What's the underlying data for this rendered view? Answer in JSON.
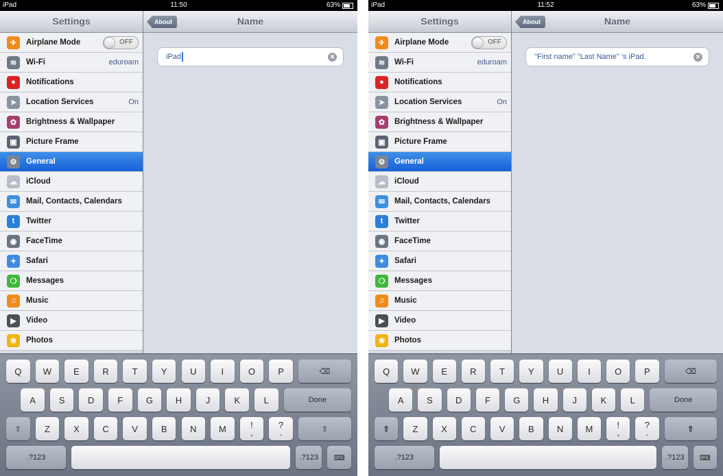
{
  "screens": [
    {
      "status": {
        "carrier": "iPad",
        "time": "11:50",
        "battery": "63%"
      },
      "sidebar_title": "Settings",
      "items": [
        {
          "label": "Airplane Mode",
          "toggle": "OFF",
          "icon": "airplane-icon",
          "color": "#f08a1a",
          "glyph": "✈"
        },
        {
          "label": "Wi-Fi",
          "value": "eduroam",
          "icon": "wifi-icon",
          "color": "#6f7a88",
          "glyph": "≋"
        },
        {
          "label": "Notifications",
          "icon": "notifications-icon",
          "color": "#d92424",
          "glyph": "●"
        },
        {
          "label": "Location Services",
          "value": "On",
          "icon": "location-icon",
          "color": "#8892a0",
          "glyph": "➤"
        },
        {
          "label": "Brightness & Wallpaper",
          "icon": "brightness-icon",
          "color": "#a43f6f",
          "glyph": "✿"
        },
        {
          "label": "Picture Frame",
          "icon": "picture-frame-icon",
          "color": "#5b6472",
          "glyph": "▣"
        },
        {
          "label": "General",
          "icon": "gear-icon",
          "color": "#7c8591",
          "glyph": "⚙",
          "selected": true
        },
        {
          "label": "iCloud",
          "icon": "cloud-icon",
          "color": "#b7bdc6",
          "glyph": "☁"
        },
        {
          "label": "Mail, Contacts, Calendars",
          "icon": "mail-icon",
          "color": "#3e8fe0",
          "glyph": "✉"
        },
        {
          "label": "Twitter",
          "icon": "twitter-icon",
          "color": "#2b7fd9",
          "glyph": "t"
        },
        {
          "label": "FaceTime",
          "icon": "facetime-icon",
          "color": "#6a7482",
          "glyph": "◉"
        },
        {
          "label": "Safari",
          "icon": "safari-icon",
          "color": "#3d8ce0",
          "glyph": "✦"
        },
        {
          "label": "Messages",
          "icon": "messages-icon",
          "color": "#3fb83a",
          "glyph": "❍"
        },
        {
          "label": "Music",
          "icon": "music-icon",
          "color": "#f08c1c",
          "glyph": "♫"
        },
        {
          "label": "Video",
          "icon": "video-icon",
          "color": "#4a4f58",
          "glyph": "▶"
        },
        {
          "label": "Photos",
          "icon": "photos-icon",
          "color": "#f2b414",
          "glyph": "❀"
        }
      ],
      "back_label": "About",
      "detail_title": "Name",
      "name_value": "iPad",
      "cursor": true,
      "shift_active": false
    },
    {
      "status": {
        "carrier": "iPad",
        "time": "11:52",
        "battery": "63%"
      },
      "sidebar_title": "Settings",
      "items": [
        {
          "label": "Airplane Mode",
          "toggle": "OFF",
          "icon": "airplane-icon",
          "color": "#f08a1a",
          "glyph": "✈"
        },
        {
          "label": "Wi-Fi",
          "value": "eduroam",
          "icon": "wifi-icon",
          "color": "#6f7a88",
          "glyph": "≋"
        },
        {
          "label": "Notifications",
          "icon": "notifications-icon",
          "color": "#d92424",
          "glyph": "●"
        },
        {
          "label": "Location Services",
          "value": "On",
          "icon": "location-icon",
          "color": "#8892a0",
          "glyph": "➤"
        },
        {
          "label": "Brightness & Wallpaper",
          "icon": "brightness-icon",
          "color": "#a43f6f",
          "glyph": "✿"
        },
        {
          "label": "Picture Frame",
          "icon": "picture-frame-icon",
          "color": "#5b6472",
          "glyph": "▣"
        },
        {
          "label": "General",
          "icon": "gear-icon",
          "color": "#7c8591",
          "glyph": "⚙",
          "selected": true
        },
        {
          "label": "iCloud",
          "icon": "cloud-icon",
          "color": "#b7bdc6",
          "glyph": "☁"
        },
        {
          "label": "Mail, Contacts, Calendars",
          "icon": "mail-icon",
          "color": "#3e8fe0",
          "glyph": "✉"
        },
        {
          "label": "Twitter",
          "icon": "twitter-icon",
          "color": "#2b7fd9",
          "glyph": "t"
        },
        {
          "label": "FaceTime",
          "icon": "facetime-icon",
          "color": "#6a7482",
          "glyph": "◉"
        },
        {
          "label": "Safari",
          "icon": "safari-icon",
          "color": "#3d8ce0",
          "glyph": "✦"
        },
        {
          "label": "Messages",
          "icon": "messages-icon",
          "color": "#3fb83a",
          "glyph": "❍"
        },
        {
          "label": "Music",
          "icon": "music-icon",
          "color": "#f08c1c",
          "glyph": "♫"
        },
        {
          "label": "Video",
          "icon": "video-icon",
          "color": "#4a4f58",
          "glyph": "▶"
        },
        {
          "label": "Photos",
          "icon": "photos-icon",
          "color": "#f2b414",
          "glyph": "❀"
        }
      ],
      "back_label": "About",
      "detail_title": "Name",
      "name_value": "\"First name\" \"Last Name\" 's iPad.",
      "cursor": false,
      "shift_active": true
    }
  ],
  "keyboard": {
    "row1": [
      "Q",
      "W",
      "E",
      "R",
      "T",
      "Y",
      "U",
      "I",
      "O",
      "P"
    ],
    "row2": [
      "A",
      "S",
      "D",
      "F",
      "G",
      "H",
      "J",
      "K",
      "L"
    ],
    "row3": [
      "Z",
      "X",
      "C",
      "V",
      "B",
      "N",
      "M"
    ],
    "punct1": [
      "!",
      ","
    ],
    "punct2": [
      "?",
      "."
    ],
    "done_label": "Done",
    "numbers_label": ".?123",
    "backspace_glyph": "⌫",
    "shift_glyph": "⇧",
    "hide_keyboard_glyph": "⌨"
  },
  "colors": {
    "selected_row": "#1661d8",
    "shift_active": "#1f63d6"
  }
}
